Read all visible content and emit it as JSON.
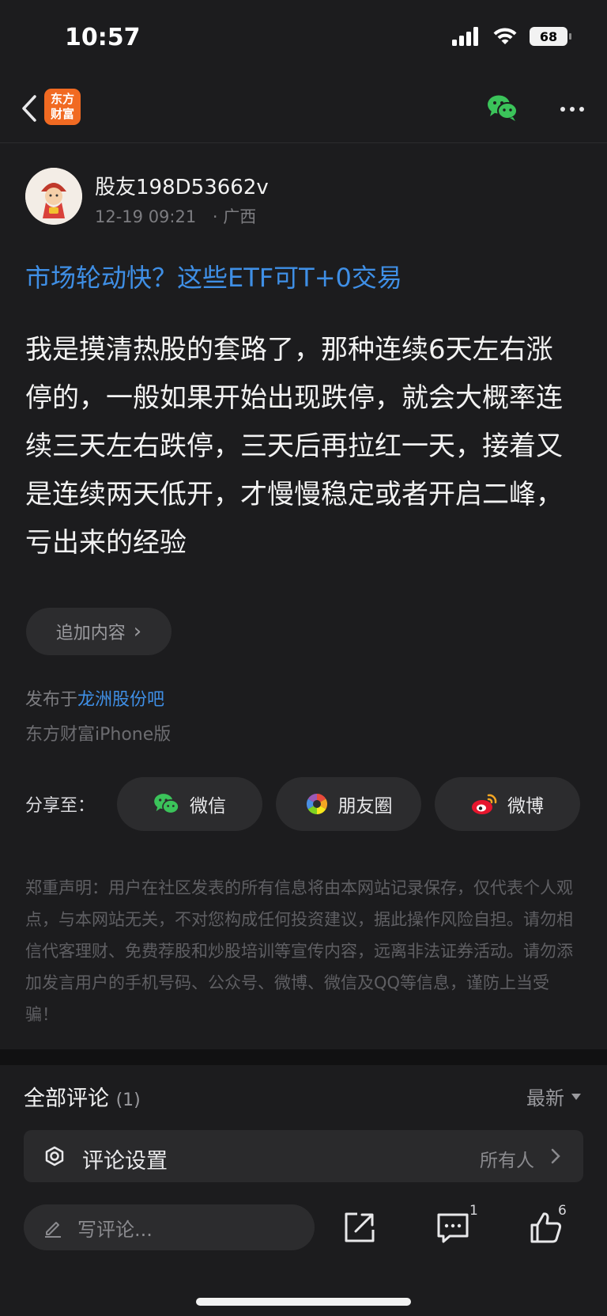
{
  "status_bar": {
    "time": "10:57",
    "battery": "68"
  },
  "nav": {
    "logo_text": "东方财富",
    "icons": [
      "back-chevron-icon",
      "wechat-icon",
      "more-icon"
    ]
  },
  "author": {
    "name": "股友198D53662v",
    "time": "12-19 09:21",
    "location": "· 广西"
  },
  "post": {
    "title": "市场轮动快？这些ETF可T+0交易",
    "body": "我是摸清热股的套路了，那种连续6天左右涨停的，一般如果开始出现跌停，就会大概率连续三天左右跌停，三天后再拉红一天，接着又是连续两天低开，才慢慢稳定或者开启二峰，亏出来的经验"
  },
  "add_content": {
    "label": "追加内容",
    "chevron": "›"
  },
  "published": {
    "prefix": "发布于",
    "bar_name": "龙洲股份吧",
    "platform": "东方财富iPhone版"
  },
  "share": {
    "label": "分享至：",
    "targets": [
      {
        "label": "微信",
        "icon": "wechat-icon"
      },
      {
        "label": "朋友圈",
        "icon": "moments-icon"
      },
      {
        "label": "微博",
        "icon": "weibo-icon"
      }
    ]
  },
  "disclaimer": "郑重声明：用户在社区发表的所有信息将由本网站记录保存，仅代表个人观点，与本网站无关，不对您构成任何投资建议，据此操作风险自担。请勿相信代客理财、免费荐股和炒股培训等宣传内容，远离非法证券活动。请勿添加发言用户的手机号码、公众号、微博、微信及QQ等信息，谨防上当受骗！",
  "comments": {
    "heading": "全部评论",
    "count": "(1)",
    "sort_label": "最新",
    "settings_label": "评论设置",
    "settings_value": "所有人"
  },
  "bottom_bar": {
    "input_placeholder": "写评论...",
    "comment_count": "1",
    "like_count": "6"
  },
  "colors": {
    "accent_blue": "#3f8fe6",
    "background": "#1c1c1e",
    "wechat_green": "#3bc35a",
    "brand_orange": "#f16a22"
  }
}
